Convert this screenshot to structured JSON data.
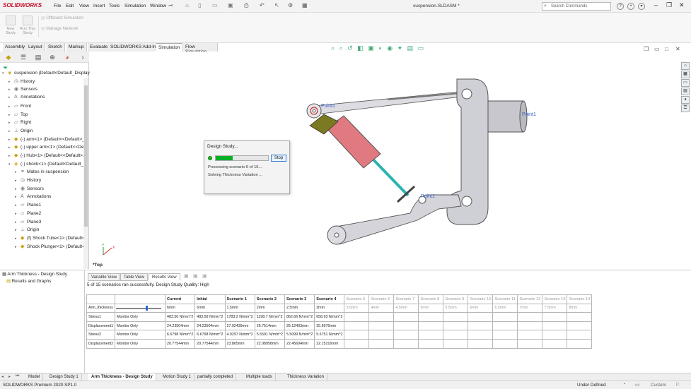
{
  "app": {
    "brand": "SOLIDWORKS",
    "document_title": "suspension.SLDASM *"
  },
  "menu": [
    "File",
    "Edit",
    "View",
    "Insert",
    "Tools",
    "Simulation",
    "Window"
  ],
  "search_placeholder": "Search Commands",
  "ribbon": {
    "new_study": "New Study",
    "run_study": "Run This Study",
    "offboard": "Offboard Simulation",
    "manage_network": "Manage Network"
  },
  "command_tabs": [
    "Assembly",
    "Layout",
    "Sketch",
    "Markup",
    "Evaluate",
    "SOLIDWORKS Add-Ins",
    "Simulation",
    "Flow Simulation"
  ],
  "active_command_tab": "Simulation",
  "feature_tree": [
    {
      "label": "suspension  (Default<Default_Display",
      "level": 0,
      "icon": "assembly-icon",
      "expanded": true
    },
    {
      "label": "History",
      "level": 1,
      "icon": "history-icon"
    },
    {
      "label": "Sensors",
      "level": 1,
      "icon": "sensor-icon"
    },
    {
      "label": "Annotations",
      "level": 1,
      "icon": "annotation-icon"
    },
    {
      "label": "Front",
      "level": 1,
      "icon": "plane-icon"
    },
    {
      "label": "Top",
      "level": 1,
      "icon": "plane-icon"
    },
    {
      "label": "Right",
      "level": 1,
      "icon": "plane-icon"
    },
    {
      "label": "Origin",
      "level": 1,
      "icon": "origin-icon"
    },
    {
      "label": "(-) arm<1> (Default<<Default>_...",
      "level": 1,
      "icon": "part-icon"
    },
    {
      "label": "(-) upper arm<1> (Default<<Def...",
      "level": 1,
      "icon": "part-icon"
    },
    {
      "label": "(-) Hub<1> (Default<<Default>...",
      "level": 1,
      "icon": "part-icon"
    },
    {
      "label": "(-) shock<1> (Default<Default_D",
      "level": 1,
      "icon": "subassembly-icon",
      "expanded": true
    },
    {
      "label": "Mates in suspension",
      "level": 2,
      "icon": "mates-icon"
    },
    {
      "label": "History",
      "level": 2,
      "icon": "history-icon"
    },
    {
      "label": "Sensors",
      "level": 2,
      "icon": "sensor-icon"
    },
    {
      "label": "Annotations",
      "level": 2,
      "icon": "annotation-icon"
    },
    {
      "label": "Plane1",
      "level": 2,
      "icon": "plane-icon"
    },
    {
      "label": "Plane2",
      "level": 2,
      "icon": "plane-icon"
    },
    {
      "label": "Plane3",
      "level": 2,
      "icon": "plane-icon"
    },
    {
      "label": "Origin",
      "level": 2,
      "icon": "origin-icon"
    },
    {
      "label": "(f) Shock Tube<1> (Default<",
      "level": 2,
      "icon": "part-icon"
    },
    {
      "label": "Shock Plunger<1> (Default<",
      "level": 2,
      "icon": "part-icon"
    }
  ],
  "viewport": {
    "view_label": "*Top",
    "point_labels": [
      "Point1",
      "Point1",
      "Point1"
    ],
    "triad": {
      "x": "X",
      "y": "Y"
    }
  },
  "progress_dialog": {
    "title": "Design Study...",
    "progress": 0.33,
    "stop_label": "Stop",
    "line1": "Processing scenario 6 of 15...",
    "line2": "Solving Thickness Variation ..."
  },
  "study_tree": {
    "root": "Arm Thickness - Design Study",
    "child": "Results and Graphs"
  },
  "view_tabs": [
    "Variable View",
    "Table View",
    "Results View"
  ],
  "active_view_tab": "Results View",
  "status_message": "5 of 15 scenarios ran successfully. Design Study Quality: High",
  "results_table": {
    "headers": [
      "",
      "",
      "Current",
      "Initial",
      "Scenario 1",
      "Scenario 2",
      "Scenario 3",
      "Scenario 4",
      "Scenario 5",
      "Scenario 6",
      "Scenario 7",
      "Scenario 8",
      "Scenario 9",
      "Scenario 10",
      "Scenario 11",
      "Scenario 12",
      "Scenario 13",
      "Scenario 14"
    ],
    "completed_columns": 8,
    "arm_thickness_slider": 0.68,
    "rows": [
      [
        "Arm_thickness",
        "",
        "6mm",
        "6mm",
        "1.5mm",
        "2mm",
        "2.5mm",
        "3mm",
        "3.5mm",
        "4mm",
        "4.5mm",
        "5mm",
        "5.5mm",
        "6mm",
        "6.5mm",
        "7mm",
        "7.5mm",
        "8mm"
      ],
      [
        "Stress1",
        "Monitor Only",
        "483.56 N/mm^2",
        "483.56 N/mm^2",
        "1783.2 N/mm^2",
        "1198.7 N/mm^2",
        "862.66 N/mm^2",
        "658.93 N/mm^2",
        "",
        "",
        "",
        "",
        "",
        "",
        "",
        "",
        "",
        ""
      ],
      [
        "Displacement1",
        "Monitor Only",
        "24.23504mm",
        "24.23504mm",
        "27.92439mm",
        "26.7514mm",
        "26.12403mm",
        "25.6976mm",
        "",
        "",
        "",
        "",
        "",
        "",
        "",
        "",
        "",
        ""
      ],
      [
        "Stress2",
        "Monitor Only",
        "6.6798 N/mm^2",
        "6.6798 N/mm^2",
        "4.9297 N/mm^2",
        "5.5591 N/mm^2",
        "5.5099 N/mm^2",
        "5.6751 N/mm^2",
        "",
        "",
        "",
        "",
        "",
        "",
        "",
        "",
        "",
        ""
      ],
      [
        "Displacement2",
        "Monitor Only",
        "20.77544mm",
        "20.77544mm",
        "23.865mm",
        "22.98958mm",
        "22.45604mm",
        "22.15216mm",
        "",
        "",
        "",
        "",
        "",
        "",
        "",
        "",
        "",
        ""
      ]
    ]
  },
  "bottom_tabs": [
    "Model",
    "Design Study 1",
    "Arm Thickness - Design Study",
    "Motion Study 1",
    "partially completed",
    "Multiple loads",
    "Thickness Variation"
  ],
  "active_bottom_tab": "Arm Thickness - Design Study",
  "statusbar": {
    "left": "SOLIDWORKS Premium 2020 SP1.0",
    "units": "Under Defined",
    "custom": "Custom"
  },
  "colors": {
    "accent": "#2b6bd1",
    "progress": "#06b025",
    "shock_body": "#e07a80",
    "plunger": "#2bb3b3",
    "hub": "#cfcfd6",
    "arm": "#d4d4da"
  }
}
